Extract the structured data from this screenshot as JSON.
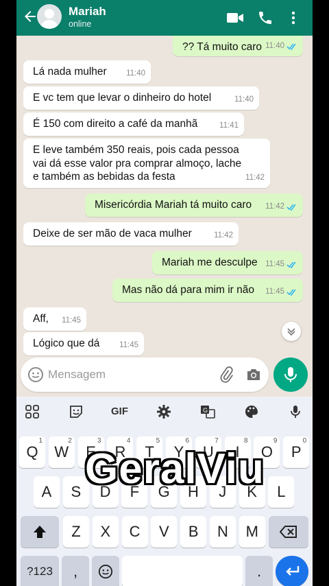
{
  "contact": {
    "name": "Mariah",
    "status": "online"
  },
  "messages": [
    {
      "dir": "out",
      "text": "?? Tá muito caro",
      "time": "11:40"
    },
    {
      "dir": "in",
      "text": "Lá nada mulher",
      "time": "11:40"
    },
    {
      "dir": "in",
      "text": "E vc tem que levar o dinheiro do hotel",
      "time": "11:40"
    },
    {
      "dir": "in",
      "text": "É 150 com direito a café da manhã",
      "time": "11:41"
    },
    {
      "dir": "in",
      "text": "E leve também 350 reais, pois cada pessoa vai dá esse valor pra comprar almoço, lache e também as bebidas da festa",
      "time": "11:42"
    },
    {
      "dir": "out",
      "text": "Misericórdia Mariah tá muito caro",
      "time": "11:42"
    },
    {
      "dir": "in",
      "text": "Deixe de ser mão de vaca mulher",
      "time": "11:42"
    },
    {
      "dir": "out",
      "text": "Mariah me desculpe",
      "time": "11:45"
    },
    {
      "dir": "out",
      "text": "Mas não dá para mim ir não",
      "time": "11:45"
    },
    {
      "dir": "in",
      "text": "Aff,",
      "time": "11:45"
    },
    {
      "dir": "in",
      "text": "Lógico que dá",
      "time": "11:45"
    }
  ],
  "composer": {
    "placeholder": "Mensagem"
  },
  "keyboard": {
    "toolbar": {
      "gif_label": "GIF"
    },
    "row1": [
      {
        "key": "Q",
        "hint": "1"
      },
      {
        "key": "W",
        "hint": "2"
      },
      {
        "key": "E",
        "hint": "3"
      },
      {
        "key": "R",
        "hint": "4"
      },
      {
        "key": "T",
        "hint": "5"
      },
      {
        "key": "Y",
        "hint": "6"
      },
      {
        "key": "U",
        "hint": "7"
      },
      {
        "key": "I",
        "hint": "8"
      },
      {
        "key": "O",
        "hint": "9"
      },
      {
        "key": "P",
        "hint": "0"
      }
    ],
    "row2": [
      "A",
      "S",
      "D",
      "F",
      "G",
      "H",
      "J",
      "K",
      "L"
    ],
    "row3": [
      "Z",
      "X",
      "C",
      "V",
      "B",
      "N",
      "M"
    ],
    "symbols_label": "?123",
    "comma_label": ",",
    "period_label": "."
  },
  "watermark": "GeralViu",
  "colors": {
    "header": "#0a7f6a",
    "outgoing": "#dcf8c6",
    "incoming": "#ffffff",
    "accent": "#00a884",
    "enter": "#1a73e8"
  }
}
